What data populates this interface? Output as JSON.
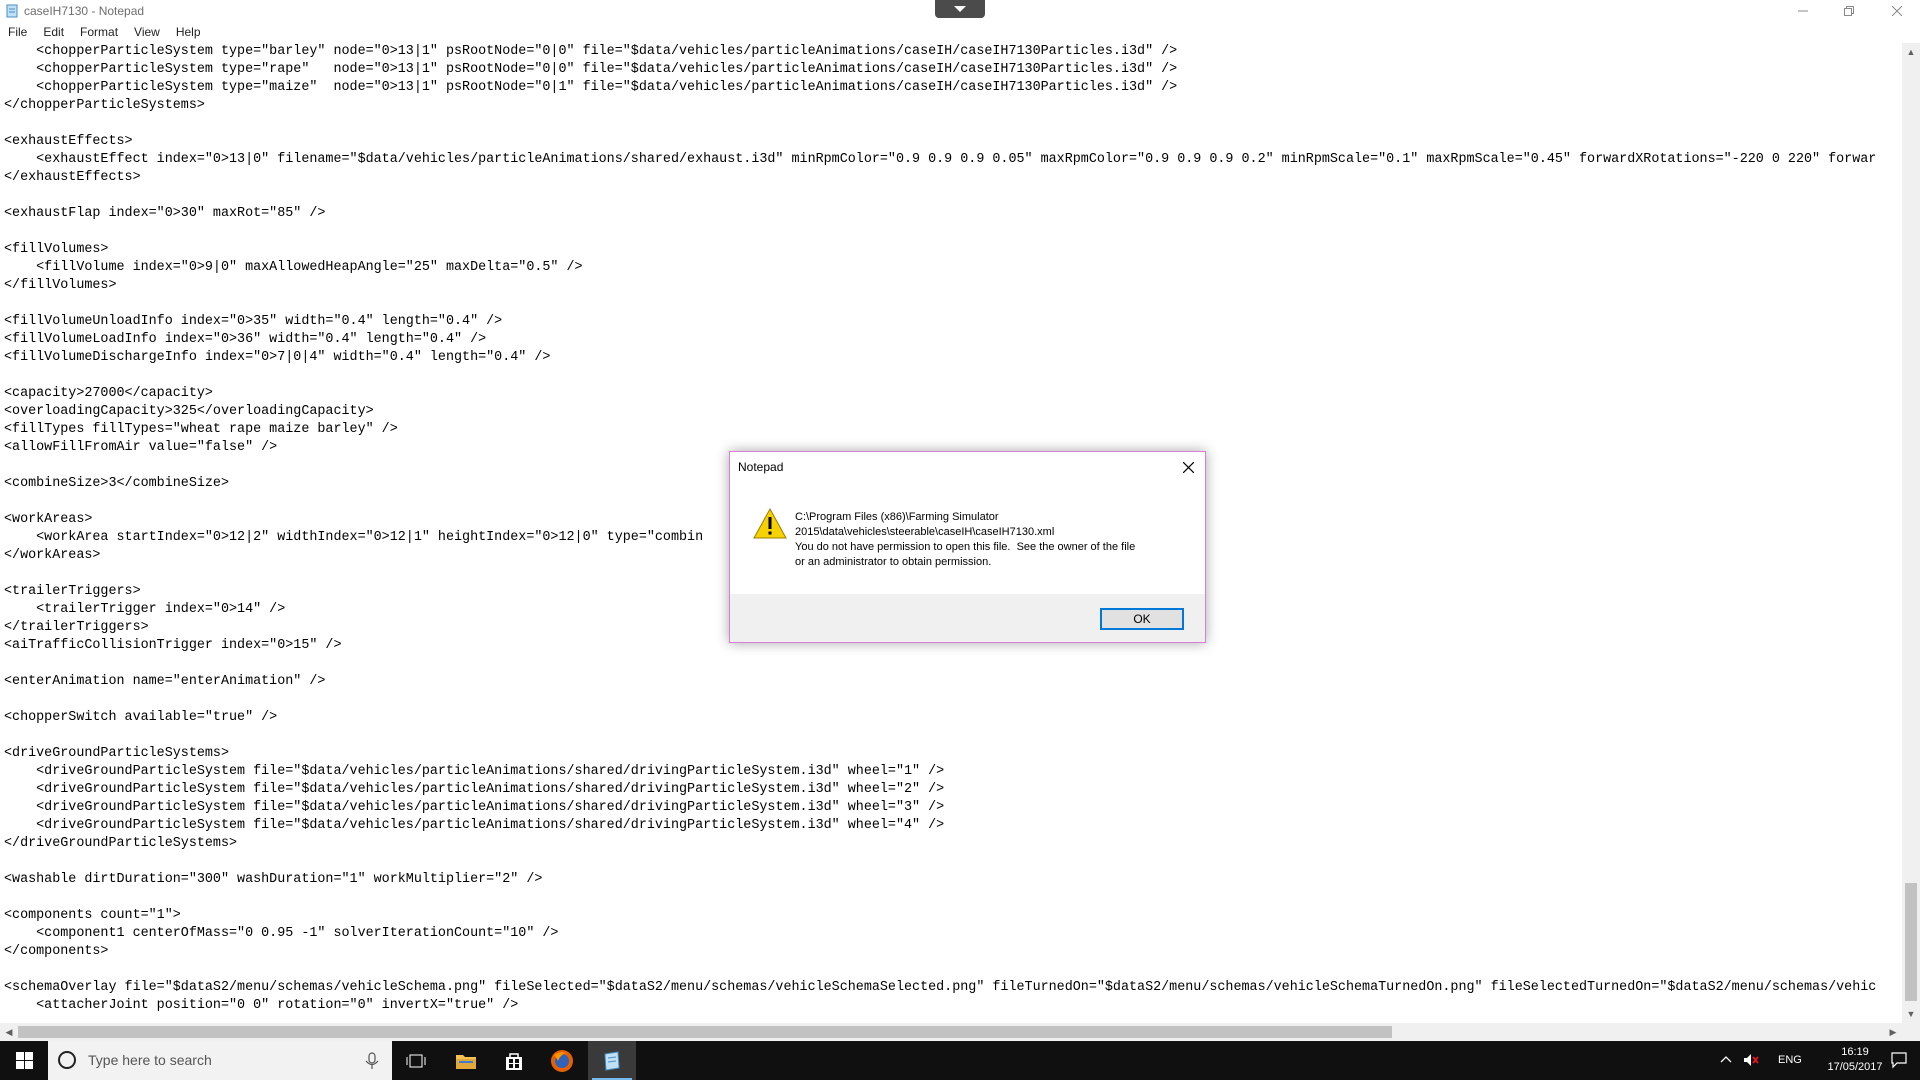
{
  "window": {
    "title": "caseIH7130 - Notepad"
  },
  "menu": {
    "items": [
      "File",
      "Edit",
      "Format",
      "View",
      "Help"
    ]
  },
  "editor": {
    "lines": [
      "    <chopperParticleSystem type=\"barley\" node=\"0>13|1\" psRootNode=\"0|0\" file=\"$data/vehicles/particleAnimations/caseIH/caseIH7130Particles.i3d\" />",
      "    <chopperParticleSystem type=\"rape\"   node=\"0>13|1\" psRootNode=\"0|0\" file=\"$data/vehicles/particleAnimations/caseIH/caseIH7130Particles.i3d\" />",
      "    <chopperParticleSystem type=\"maize\"  node=\"0>13|1\" psRootNode=\"0|1\" file=\"$data/vehicles/particleAnimations/caseIH/caseIH7130Particles.i3d\" />",
      "</chopperParticleSystems>",
      "",
      "<exhaustEffects>",
      "    <exhaustEffect index=\"0>13|0\" filename=\"$data/vehicles/particleAnimations/shared/exhaust.i3d\" minRpmColor=\"0.9 0.9 0.9 0.05\" maxRpmColor=\"0.9 0.9 0.9 0.2\" minRpmScale=\"0.1\" maxRpmScale=\"0.45\" forwardXRotations=\"-220 0 220\" forwar",
      "</exhaustEffects>",
      "",
      "<exhaustFlap index=\"0>30\" maxRot=\"85\" />",
      "",
      "<fillVolumes>",
      "    <fillVolume index=\"0>9|0\" maxAllowedHeapAngle=\"25\" maxDelta=\"0.5\" />",
      "</fillVolumes>",
      "",
      "<fillVolumeUnloadInfo index=\"0>35\" width=\"0.4\" length=\"0.4\" />",
      "<fillVolumeLoadInfo index=\"0>36\" width=\"0.4\" length=\"0.4\" />",
      "<fillVolumeDischargeInfo index=\"0>7|0|4\" width=\"0.4\" length=\"0.4\" />",
      "",
      "<capacity>27000</capacity>",
      "<overloadingCapacity>325</overloadingCapacity>",
      "<fillTypes fillTypes=\"wheat rape maize barley\" />",
      "<allowFillFromAir value=\"false\" />",
      "",
      "<combineSize>3</combineSize>",
      "",
      "<workAreas>",
      "    <workArea startIndex=\"0>12|2\" widthIndex=\"0>12|1\" heightIndex=\"0>12|0\" type=\"combin",
      "</workAreas>",
      "",
      "<trailerTriggers>",
      "    <trailerTrigger index=\"0>14\" />",
      "</trailerTriggers>",
      "<aiTrafficCollisionTrigger index=\"0>15\" />",
      "",
      "<enterAnimation name=\"enterAnimation\" />",
      "",
      "<chopperSwitch available=\"true\" />",
      "",
      "<driveGroundParticleSystems>",
      "    <driveGroundParticleSystem file=\"$data/vehicles/particleAnimations/shared/drivingParticleSystem.i3d\" wheel=\"1\" />",
      "    <driveGroundParticleSystem file=\"$data/vehicles/particleAnimations/shared/drivingParticleSystem.i3d\" wheel=\"2\" />",
      "    <driveGroundParticleSystem file=\"$data/vehicles/particleAnimations/shared/drivingParticleSystem.i3d\" wheel=\"3\" />",
      "    <driveGroundParticleSystem file=\"$data/vehicles/particleAnimations/shared/drivingParticleSystem.i3d\" wheel=\"4\" />",
      "</driveGroundParticleSystems>",
      "",
      "<washable dirtDuration=\"300\" washDuration=\"1\" workMultiplier=\"2\" />",
      "",
      "<components count=\"1\">",
      "    <component1 centerOfMass=\"0 0.95 -1\" solverIterationCount=\"10\" />",
      "</components>",
      "",
      "<schemaOverlay file=\"$dataS2/menu/schemas/vehicleSchema.png\" fileSelected=\"$dataS2/menu/schemas/vehicleSchemaSelected.png\" fileTurnedOn=\"$dataS2/menu/schemas/vehicleSchemaTurnedOn.png\" fileSelectedTurnedOn=\"$dataS2/menu/schemas/vehic",
      "    <attacherJoint position=\"0 0\" rotation=\"0\" invertX=\"true\" />"
    ]
  },
  "dialog": {
    "title": "Notepad",
    "message_lines": [
      "C:\\Program Files (x86)\\Farming Simulator",
      "2015\\data\\vehicles\\steerable\\caseIH\\caseIH7130.xml",
      "You do not have permission to open this file.  See the owner of the file",
      "or an administrator to obtain permission."
    ],
    "ok_label": "OK"
  },
  "taskbar": {
    "search_placeholder": "Type here to search",
    "language": "ENG",
    "time": "16:19",
    "date": "17/05/2017"
  },
  "colors": {
    "accent": "#0078d7",
    "dialog_border": "#d77ed5",
    "warning_yellow": "#f6d200",
    "taskbar_bg": "#101010"
  }
}
